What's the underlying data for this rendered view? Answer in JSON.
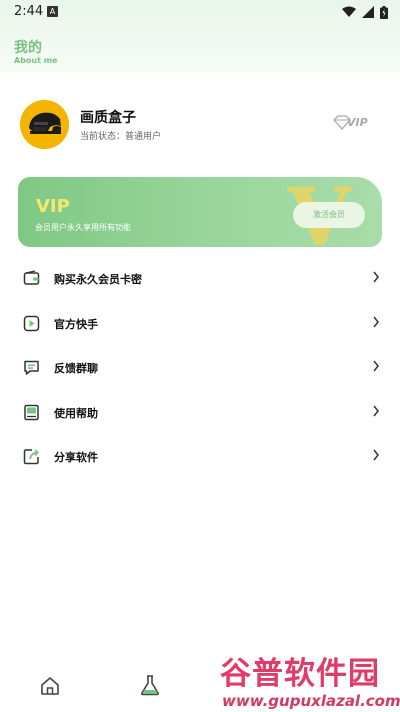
{
  "status_bar": {
    "time": "2:44",
    "notification": "A"
  },
  "header": {
    "title": "我的",
    "subtitle": "About me"
  },
  "profile": {
    "name": "画质盒子",
    "status": "当前状态：普通用户",
    "badge": "VIP"
  },
  "vip_card": {
    "title": "VIP",
    "description": "会员用户永久享用所有功能",
    "button_label": "激活会员",
    "emblem": "V"
  },
  "menu": {
    "items": [
      {
        "label": "购买永久会员卡密",
        "icon": "wallet-icon"
      },
      {
        "label": "官方快手",
        "icon": "play-icon"
      },
      {
        "label": "反馈群聊",
        "icon": "chat-icon"
      },
      {
        "label": "使用帮助",
        "icon": "book-icon"
      },
      {
        "label": "分享软件",
        "icon": "share-icon"
      }
    ]
  },
  "bottom_nav": {
    "items": [
      {
        "icon": "home-icon"
      },
      {
        "icon": "flask-icon"
      }
    ]
  },
  "watermark": {
    "text": "谷普软件园",
    "url": "www.gupuxlazal.com"
  },
  "colors": {
    "accent": "#7cc083",
    "vip_gold": "#f5e86c",
    "watermark": "#e03c6a"
  }
}
